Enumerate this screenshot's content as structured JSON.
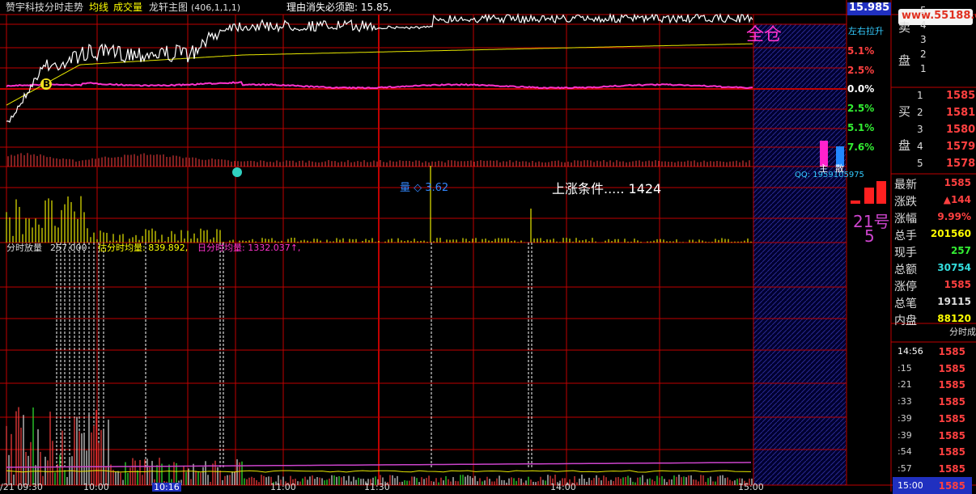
{
  "header": {
    "stock_title": "赞宇科技分时走势",
    "avg_line_label": "均线",
    "volume_label": "成交量",
    "indicator": "龙轩主图",
    "params": "(406,1,1,1)",
    "reason": "理由消失必须跑: 15.85,",
    "current_price": "15.985",
    "left_toggle": "左右拉升",
    "logo": "www.55188.com"
  },
  "chart_annotations": {
    "full_position": "全仓",
    "volume_marker": "量 ◇ 3.62",
    "rise_condition": "上涨条件..... 1424",
    "qq": "QQ: 1959105975",
    "no21": "21号",
    "no5": "5",
    "buy_sign": "B",
    "mini_label_a": "主",
    "mini_label_b": "散"
  },
  "right_axis": {
    "pct_labels": [
      "5.1%",
      "2.5%",
      "0.0%",
      "2.5%",
      "5.1%",
      "7.6%"
    ],
    "pct_colors": [
      "#ff4040",
      "#ff4040",
      "#ffffff",
      "#33ee33",
      "#33ee33",
      "#33ee33"
    ]
  },
  "volume_header": {
    "label": "分时放量",
    "value": "257.000",
    "avg_label": "估分时均量: 839.892,",
    "day_avg_label": "日分时均量: 1332.037↑,"
  },
  "time_axis": {
    "labels": [
      "/21 09:30",
      "10:00",
      "10:16",
      "11:00",
      "11:30",
      "14:00",
      "15:00"
    ]
  },
  "sell_panel": {
    "label_chars": [
      "卖",
      "盘"
    ],
    "levels": [
      "5",
      "4",
      "3",
      "2",
      "1"
    ]
  },
  "buy_panel": {
    "label_chars": [
      "买",
      "盘"
    ],
    "levels": [
      {
        "n": "1",
        "p": "1585"
      },
      {
        "n": "2",
        "p": "1581"
      },
      {
        "n": "3",
        "p": "1580"
      },
      {
        "n": "4",
        "p": "1579"
      },
      {
        "n": "5",
        "p": "1578"
      }
    ]
  },
  "quote": [
    {
      "k": "最新",
      "v": "1585",
      "c": "#ff4040"
    },
    {
      "k": "涨跌",
      "v": "▲144",
      "c": "#ff4040"
    },
    {
      "k": "涨幅",
      "v": "9.99%",
      "c": "#ff4040"
    },
    {
      "k": "总手",
      "v": "201560",
      "c": "#ffff00"
    },
    {
      "k": "现手",
      "v": "257",
      "c": "#33ee33"
    },
    {
      "k": "总额",
      "v": "30754",
      "c": "#33dddd"
    },
    {
      "k": "涨停",
      "v": "1585",
      "c": "#ff4040"
    },
    {
      "k": "总笔",
      "v": "19115",
      "c": "#dddddd"
    },
    {
      "k": "内盘",
      "v": "88120",
      "c": "#ffff00"
    }
  ],
  "ticks": {
    "tab": "分时成",
    "rows": [
      {
        "t": "14:56",
        "p": "1585"
      },
      {
        "t": ":15",
        "p": "1585"
      },
      {
        "t": ":21",
        "p": "1585"
      },
      {
        "t": ":33",
        "p": "1585"
      },
      {
        "t": ":39",
        "p": "1585"
      },
      {
        "t": ":39",
        "p": "1585"
      },
      {
        "t": ":54",
        "p": "1585"
      },
      {
        "t": ":57",
        "p": "1585"
      },
      {
        "t": "15:00",
        "p": "1585"
      }
    ]
  },
  "colors": {
    "grid": "#c00000",
    "price_line": "#ffffff",
    "avg_line": "#e8e800",
    "indicator_line": "#ff33cc",
    "volume": "#e8e800",
    "up": "#ff4040",
    "down": "#33ee33"
  }
}
